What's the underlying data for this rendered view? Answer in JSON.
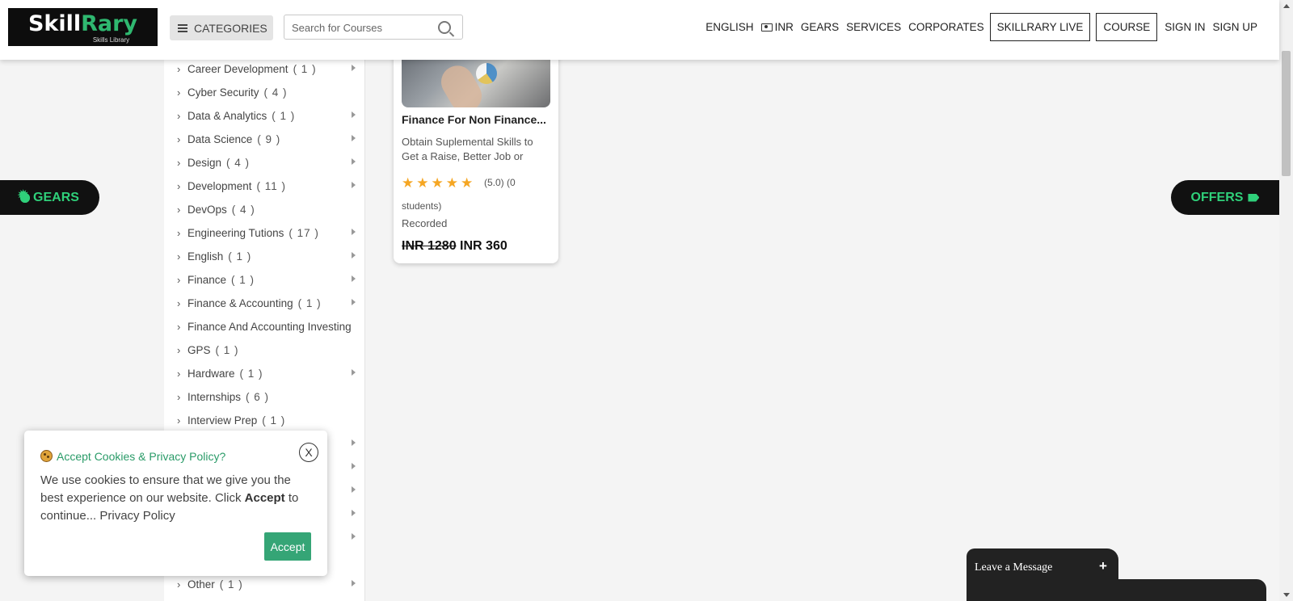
{
  "header": {
    "logo_main_a": "Skill",
    "logo_main_b": "Rary",
    "logo_sub": "Skills Library",
    "categories_label": "CATEGORIES",
    "search_placeholder": "Search for Courses",
    "nav": {
      "english": "ENGLISH",
      "inr": "INR",
      "gears": "GEARS",
      "services": "SERVICES",
      "corporates": "CORPORATES",
      "skillrary_live": "SKILLRARY LIVE",
      "course": "COURSE",
      "sign_in": "SIGN IN",
      "sign_up": "SIGN UP"
    }
  },
  "sidebar": {
    "categories": [
      {
        "label": "Career Development",
        "count": "( 1 )"
      },
      {
        "label": "Cyber Security",
        "count": "( 4 )"
      },
      {
        "label": "Data & Analytics",
        "count": "( 1 )"
      },
      {
        "label": "Data Science",
        "count": "( 9 )"
      },
      {
        "label": "Design",
        "count": "( 4 )"
      },
      {
        "label": "Development",
        "count": "( 11 )"
      },
      {
        "label": "DevOps",
        "count": "( 4 )"
      },
      {
        "label": "Engineering Tutions",
        "count": "( 17 )"
      },
      {
        "label": "English",
        "count": "( 1 )"
      },
      {
        "label": "Finance",
        "count": "( 1 )"
      },
      {
        "label": "Finance & Accounting",
        "count": "( 1 )"
      },
      {
        "label": "Finance And Accounting Investing",
        "count": ""
      },
      {
        "label": "GPS",
        "count": "( 1 )"
      },
      {
        "label": "Hardware",
        "count": "( 1 )"
      },
      {
        "label": "Internships",
        "count": "( 6 )"
      },
      {
        "label": "Interview Prep",
        "count": "( 1 )"
      },
      {
        "label": "Other",
        "count": "( 1 )"
      }
    ]
  },
  "course_card": {
    "title": "Finance For Non Finance...",
    "description": "Obtain Suplemental Skills to Get a Raise, Better Job or",
    "rating": 5,
    "rating_text": "(5.0) (0",
    "students_text": "students)",
    "type": "Recorded",
    "old_price": "INR 1280",
    "new_price": "INR 360"
  },
  "floating": {
    "gears": "GEARS",
    "offers": "OFFERS"
  },
  "cookie_popup": {
    "heading": "Accept Cookies & Privacy Policy?",
    "close": "X",
    "body_start": "We use cookies to ensure that we give you the best experience on our website. Click ",
    "body_bold": "Accept",
    "body_end": " to continue... Privacy Policy",
    "accept": "Accept"
  },
  "chat": {
    "label": "Leave a Message",
    "plus": "+"
  },
  "colors": {
    "accent_green": "#2fd07a",
    "accept_green": "#35a576",
    "star": "#f5a623"
  }
}
